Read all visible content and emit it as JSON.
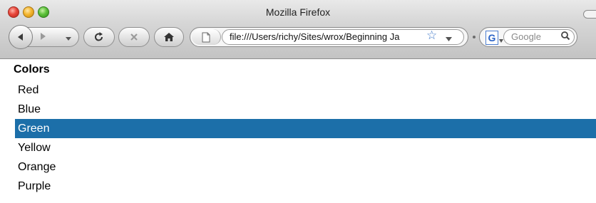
{
  "window": {
    "title": "Mozilla Firefox"
  },
  "toolbar": {
    "url": "file:///Users/richy/Sites/wrox/Beginning Ja",
    "search_placeholder": "Google",
    "search_engine_letter": "G"
  },
  "page": {
    "heading": "Colors",
    "options": [
      {
        "label": "Red",
        "selected": false
      },
      {
        "label": "Blue",
        "selected": false
      },
      {
        "label": "Green",
        "selected": true
      },
      {
        "label": "Yellow",
        "selected": false
      },
      {
        "label": "Orange",
        "selected": false
      },
      {
        "label": "Purple",
        "selected": false
      }
    ]
  },
  "colors": {
    "selection": "#1c6fa9",
    "selection_text": "#ffffff"
  },
  "icons": {
    "back": "back-arrow-icon",
    "forward": "forward-arrow-icon",
    "reload": "reload-icon",
    "stop": "stop-icon",
    "home": "home-icon",
    "page": "page-icon",
    "bookmark": "star-icon",
    "search": "magnifier-icon"
  }
}
